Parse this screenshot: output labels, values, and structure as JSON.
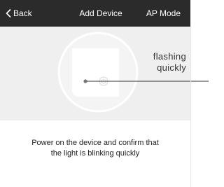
{
  "header": {
    "back_label": "Back",
    "title": "Add Device",
    "ap_mode_label": "AP Mode"
  },
  "illustration": {
    "callout_line1": "flashing",
    "callout_line2": "quickly"
  },
  "instruction": {
    "line1": "Power on the device and confirm that",
    "line2": "the light is blinking quickly"
  },
  "colors": {
    "header_bg": "#2b2b2b",
    "illustration_bg": "#efefef",
    "text": "#222222"
  },
  "icons": [
    "chevron-left-icon",
    "power-icon",
    "indicator-light-icon"
  ]
}
